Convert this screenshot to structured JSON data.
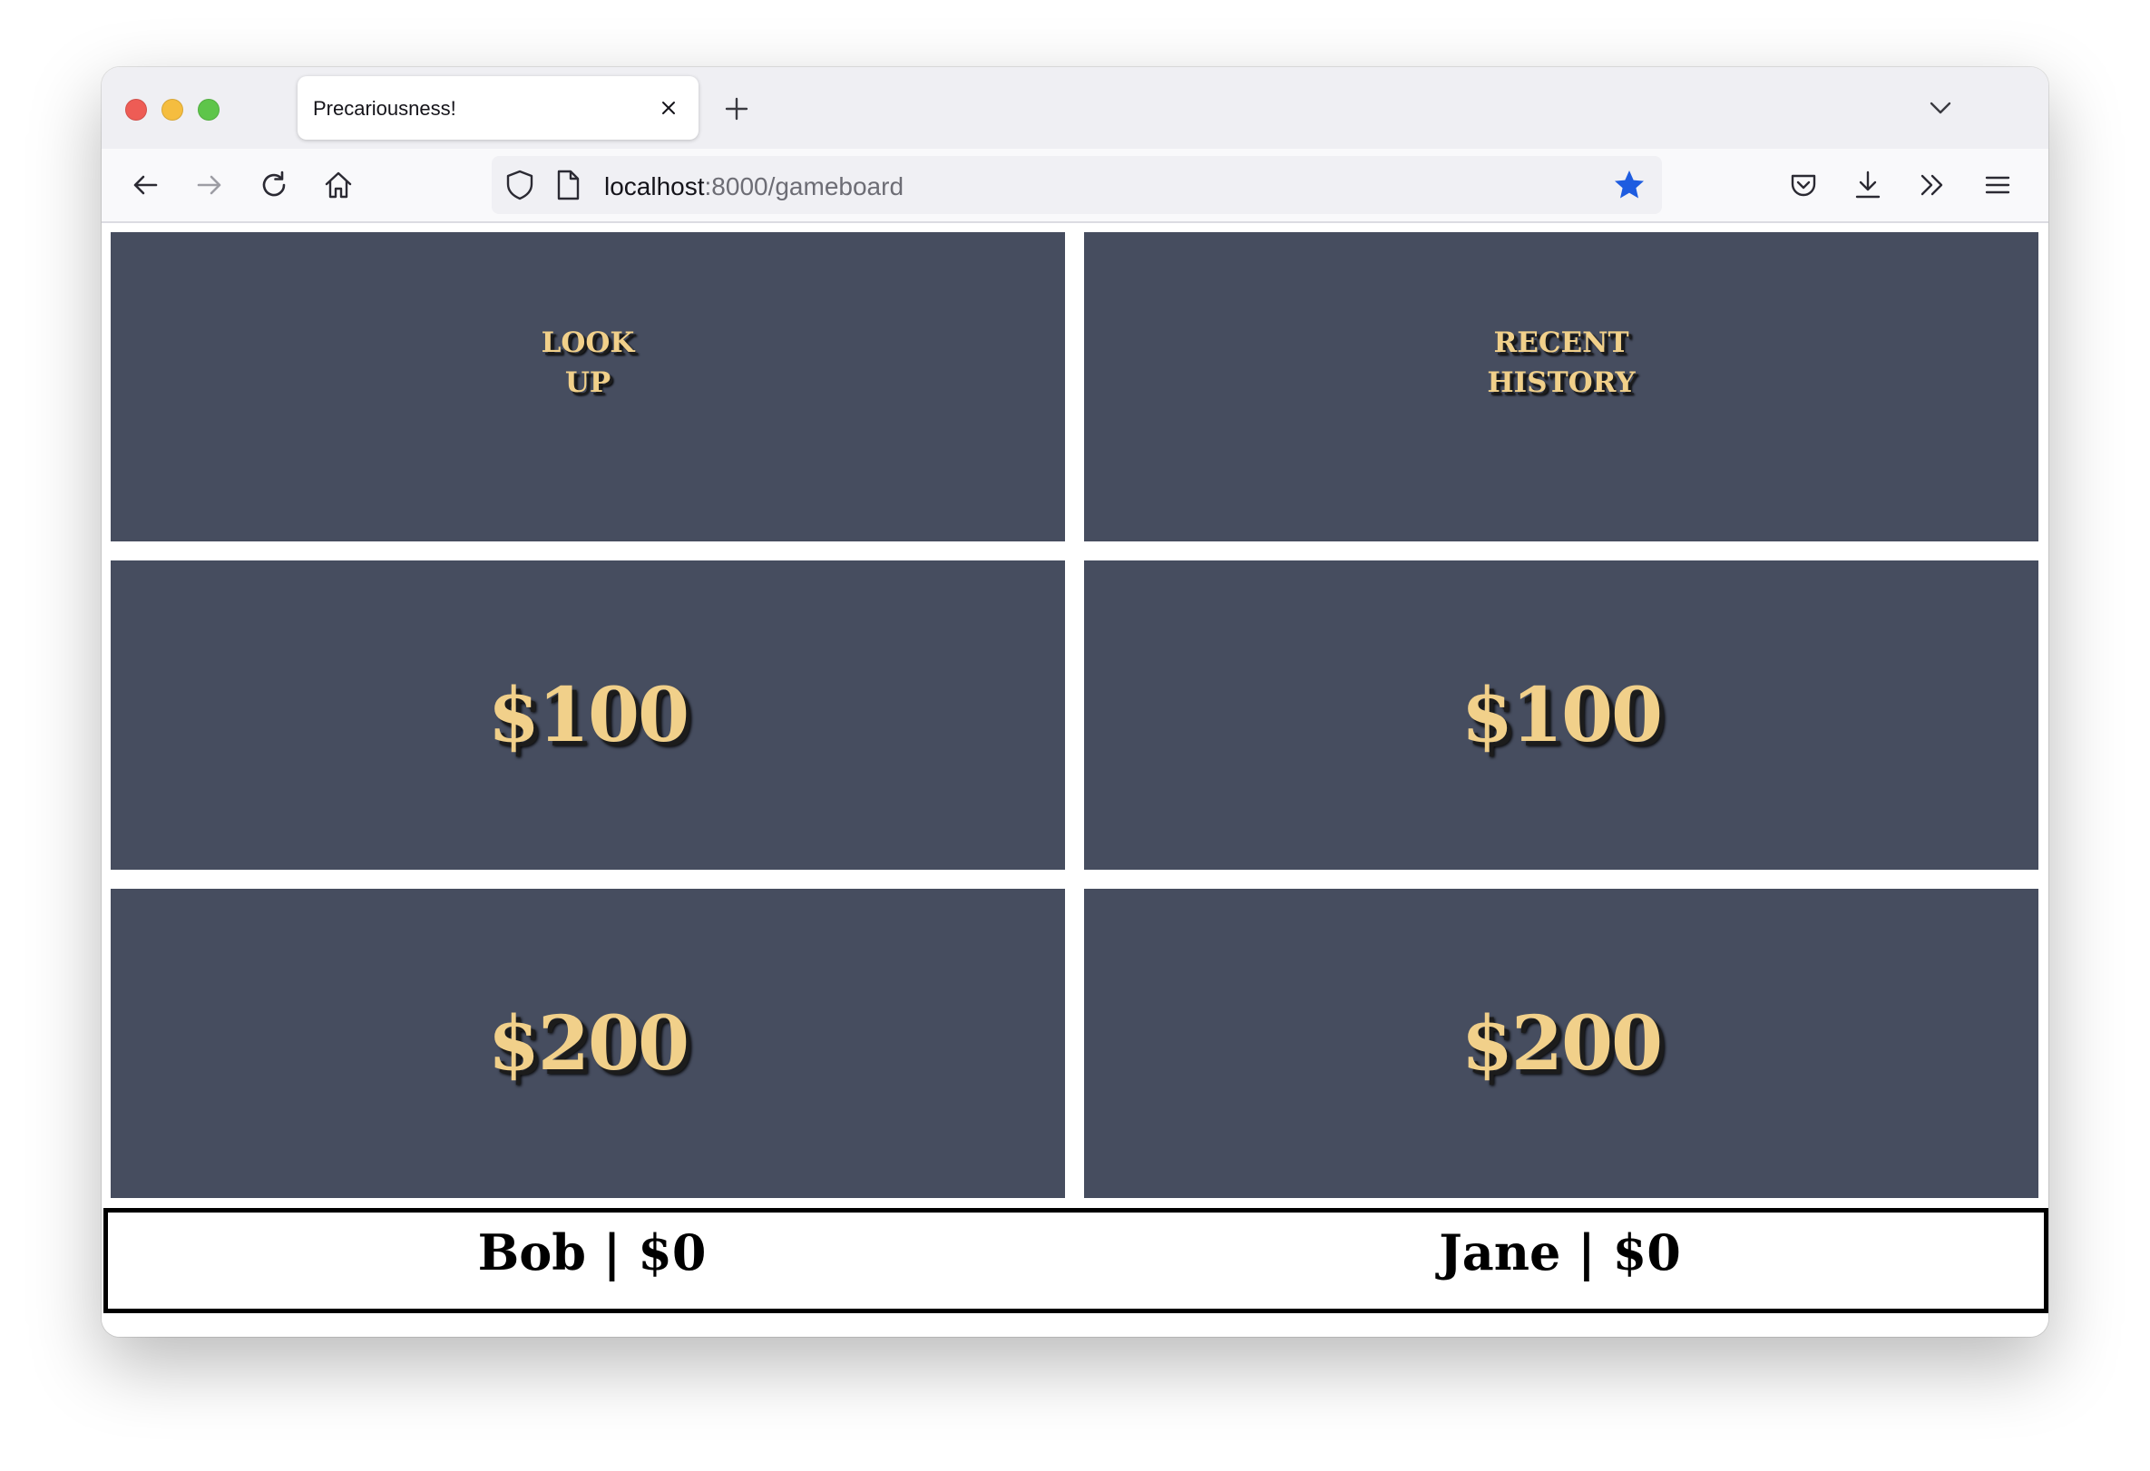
{
  "browser": {
    "tab_title": "Precariousness!",
    "url_host": "localhost",
    "url_path": ":8000/gameboard"
  },
  "board": {
    "categories": [
      {
        "line1": "LOOK",
        "line2": "UP"
      },
      {
        "line1": "RECENT",
        "line2": "HISTORY"
      }
    ],
    "rows": [
      [
        "$100",
        "$100"
      ],
      [
        "$200",
        "$200"
      ]
    ]
  },
  "players": [
    {
      "name": "Bob",
      "separator": "|",
      "score": "$0"
    },
    {
      "name": "Jane",
      "separator": "|",
      "score": "$0"
    }
  ],
  "colors": {
    "cell_bg": "#464d5f",
    "cell_text": "#f1d08a",
    "bookmark_star": "#1e5ce0"
  }
}
